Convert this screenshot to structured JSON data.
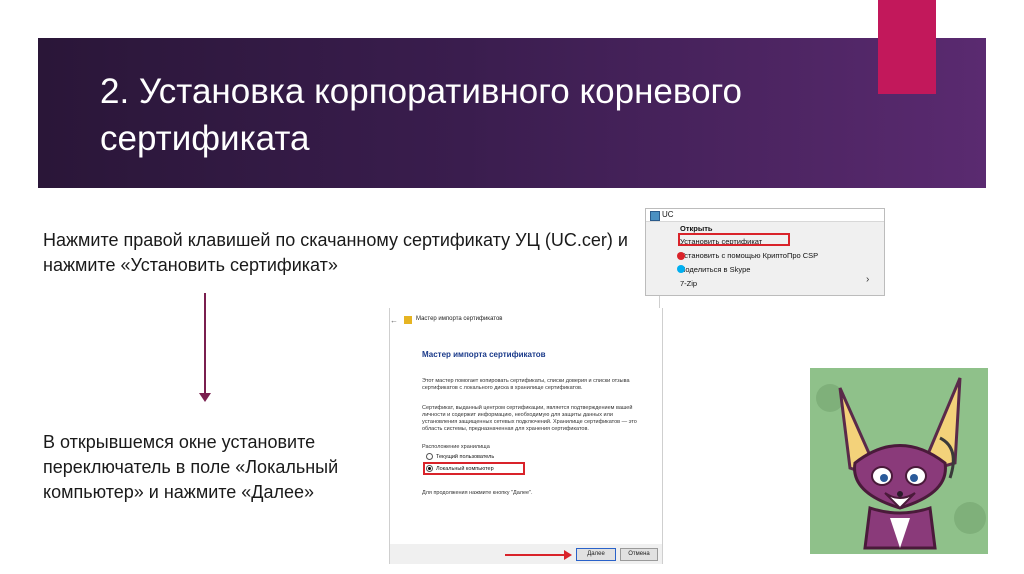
{
  "slide": {
    "title": "2. Установка корпоративного корневого сертификата",
    "instruction_1": "Нажмите правой клавишей по скачанному сертификату УЦ (UC.cer) и нажмите «Установить сертификат»",
    "instruction_2": "В открывшемся окне установите переключатель в поле «Локальный компьютер» и нажмите «Далее»"
  },
  "context_menu": {
    "file_name": "UC",
    "items": [
      "Открыть",
      "Установить сертификат",
      "Установить с помощью КриптоПро CSP",
      "Поделиться в Skype",
      "7-Zip"
    ]
  },
  "wizard": {
    "window_title": "Мастер импорта сертификатов",
    "heading": "Мастер импорта сертификатов",
    "para1": "Этот мастер помогает копировать сертификаты, списки доверия и списки отзыва сертификатов с локального диска в хранилище сертификатов.",
    "para2": "Сертификат, выданный центром сертификации, является подтверждением вашей личности и содержит информацию, необходимую для защиты данных или установления защищенных сетевых подключений. Хранилище сертификатов — это область системы, предназначенная для хранения сертификатов.",
    "store_label": "Расположение хранилища",
    "option_current_user": "Текущий пользователь",
    "option_local_machine": "Локальный компьютер",
    "continue_hint": "Для продолжения нажмите кнопку \"Далее\".",
    "next_button": "Далее",
    "cancel_button": "Отмена"
  },
  "colors": {
    "banner": "#3a1d4e",
    "accent": "#c2185b",
    "highlight": "#d9232a",
    "arrow": "#7a1f4f"
  }
}
